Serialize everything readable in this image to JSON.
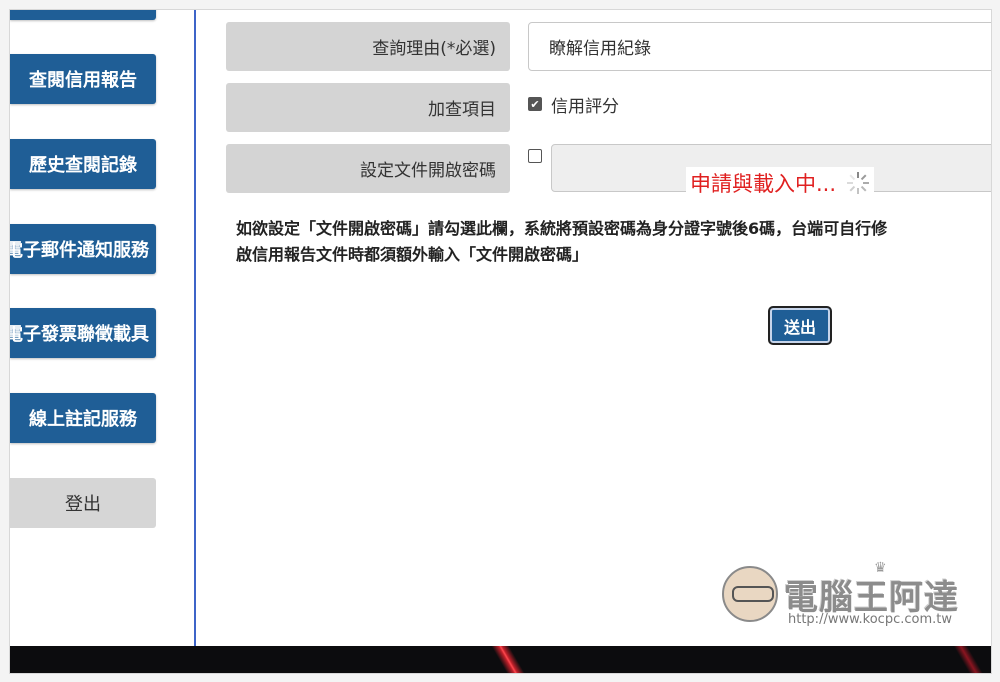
{
  "sidebar": {
    "items": [
      {
        "label": "查閱信用報告"
      },
      {
        "label": "歷史查閱記錄"
      },
      {
        "label": "電子郵件通知服務"
      },
      {
        "label": "電子發票聯徵載具"
      },
      {
        "label": "線上註記服務"
      }
    ],
    "logout_label": "登出"
  },
  "form": {
    "reason": {
      "label": "查詢理由(*必選)",
      "value": "瞭解信用紀錄"
    },
    "extra": {
      "label": "加查項目",
      "option_label": "信用評分",
      "checked": true
    },
    "password": {
      "label": "設定文件開啟密碼",
      "checked": false
    }
  },
  "loading_text": "申請與載入中...",
  "note": {
    "line1": "如欲設定「文件開啟密碼」請勾選此欄，系統將預設密碼為身分證字號後6碼，台端可自行修",
    "line2": "啟信用報告文件時都須額外輸入「文件開啟密碼」"
  },
  "submit_label": "送出",
  "watermark": {
    "title": "電腦王阿達",
    "url": "http://www.kocpc.com.tw"
  },
  "colors": {
    "primary": "#1f5e96",
    "divider": "#3d64c8",
    "loading": "#e02020",
    "label_bg": "#d4d4d4"
  },
  "icons": {
    "checkbox_checked": "checkbox-checked-icon",
    "checkbox_empty": "checkbox-empty-icon",
    "spinner": "spinner-icon"
  }
}
